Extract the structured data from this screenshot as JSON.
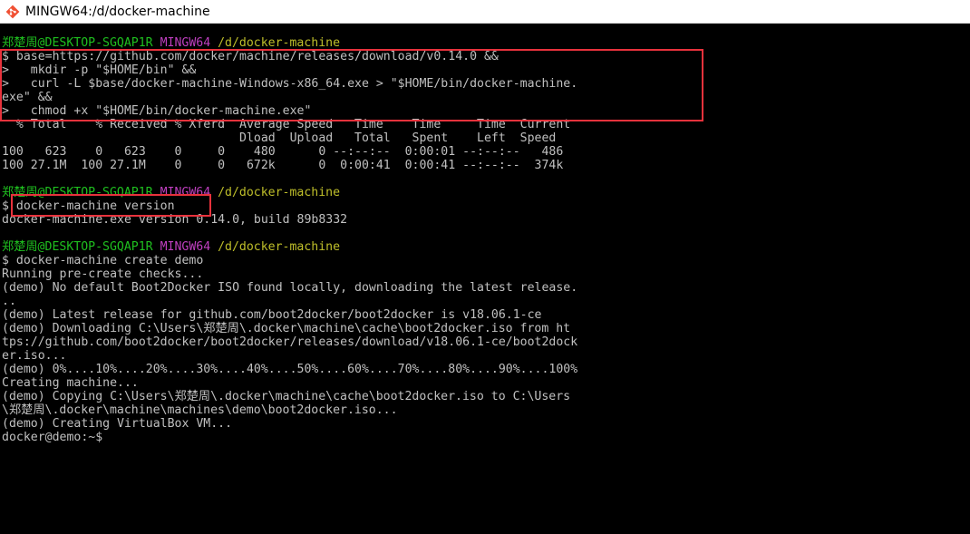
{
  "window": {
    "title": "MINGW64:/d/docker-machine",
    "icon": "git-bash-icon"
  },
  "terminal": {
    "lines": [
      {
        "type": "prompt",
        "user": "郑楚周@DESKTOP-SGQAP1R",
        "env": "MINGW64",
        "path": "/d/docker-machine"
      },
      {
        "type": "text",
        "text": "$ base=https://github.com/docker/machine/releases/download/v0.14.0 &&"
      },
      {
        "type": "text",
        "text": ">   mkdir -p \"$HOME/bin\" &&"
      },
      {
        "type": "text",
        "text": ">   curl -L $base/docker-machine-Windows-x86_64.exe > \"$HOME/bin/docker-machine."
      },
      {
        "type": "text",
        "text": "exe\" &&"
      },
      {
        "type": "text",
        "text": ">   chmod +x \"$HOME/bin/docker-machine.exe\""
      },
      {
        "type": "text",
        "text": "  % Total    % Received % Xferd  Average Speed   Time    Time     Time  Current"
      },
      {
        "type": "text",
        "text": "                                 Dload  Upload   Total   Spent    Left  Speed"
      },
      {
        "type": "text",
        "text": "100   623    0   623    0     0    480      0 --:--:--  0:00:01 --:--:--   486"
      },
      {
        "type": "text",
        "text": "100 27.1M  100 27.1M    0     0   672k      0  0:00:41  0:00:41 --:--:--  374k"
      },
      {
        "type": "blank"
      },
      {
        "type": "prompt",
        "user": "郑楚周@DESKTOP-SGQAP1R",
        "env": "MINGW64",
        "path": "/d/docker-machine"
      },
      {
        "type": "text",
        "text": "$ docker-machine version"
      },
      {
        "type": "text",
        "text": "docker-machine.exe version 0.14.0, build 89b8332"
      },
      {
        "type": "blank"
      },
      {
        "type": "prompt",
        "user": "郑楚周@DESKTOP-SGQAP1R",
        "env": "MINGW64",
        "path": "/d/docker-machine"
      },
      {
        "type": "text",
        "text": "$ docker-machine create demo"
      },
      {
        "type": "text",
        "text": "Running pre-create checks..."
      },
      {
        "type": "text",
        "text": "(demo) No default Boot2Docker ISO found locally, downloading the latest release."
      },
      {
        "type": "text",
        "text": ".."
      },
      {
        "type": "text",
        "text": "(demo) Latest release for github.com/boot2docker/boot2docker is v18.06.1-ce"
      },
      {
        "type": "text",
        "text": "(demo) Downloading C:\\Users\\郑楚周\\.docker\\machine\\cache\\boot2docker.iso from ht"
      },
      {
        "type": "text",
        "text": "tps://github.com/boot2docker/boot2docker/releases/download/v18.06.1-ce/boot2dock"
      },
      {
        "type": "text",
        "text": "er.iso..."
      },
      {
        "type": "text",
        "text": "(demo) 0%....10%....20%....30%....40%....50%....60%....70%....80%....90%....100%"
      },
      {
        "type": "text",
        "text": "Creating machine..."
      },
      {
        "type": "text",
        "text": "(demo) Copying C:\\Users\\郑楚周\\.docker\\machine\\cache\\boot2docker.iso to C:\\Users"
      },
      {
        "type": "text",
        "text": "\\郑楚周\\.docker\\machine\\machines\\demo\\boot2docker.iso..."
      },
      {
        "type": "text",
        "text": "(demo) Creating VirtualBox VM..."
      },
      {
        "type": "text",
        "text": "docker@demo:~$"
      }
    ]
  },
  "colors": {
    "background": "#000000",
    "text": "#c0c0c0",
    "prompt_user": "#1fbf1f",
    "prompt_env": "#bf3fbf",
    "prompt_path": "#bfbf2a",
    "highlight": "#e8323c"
  }
}
